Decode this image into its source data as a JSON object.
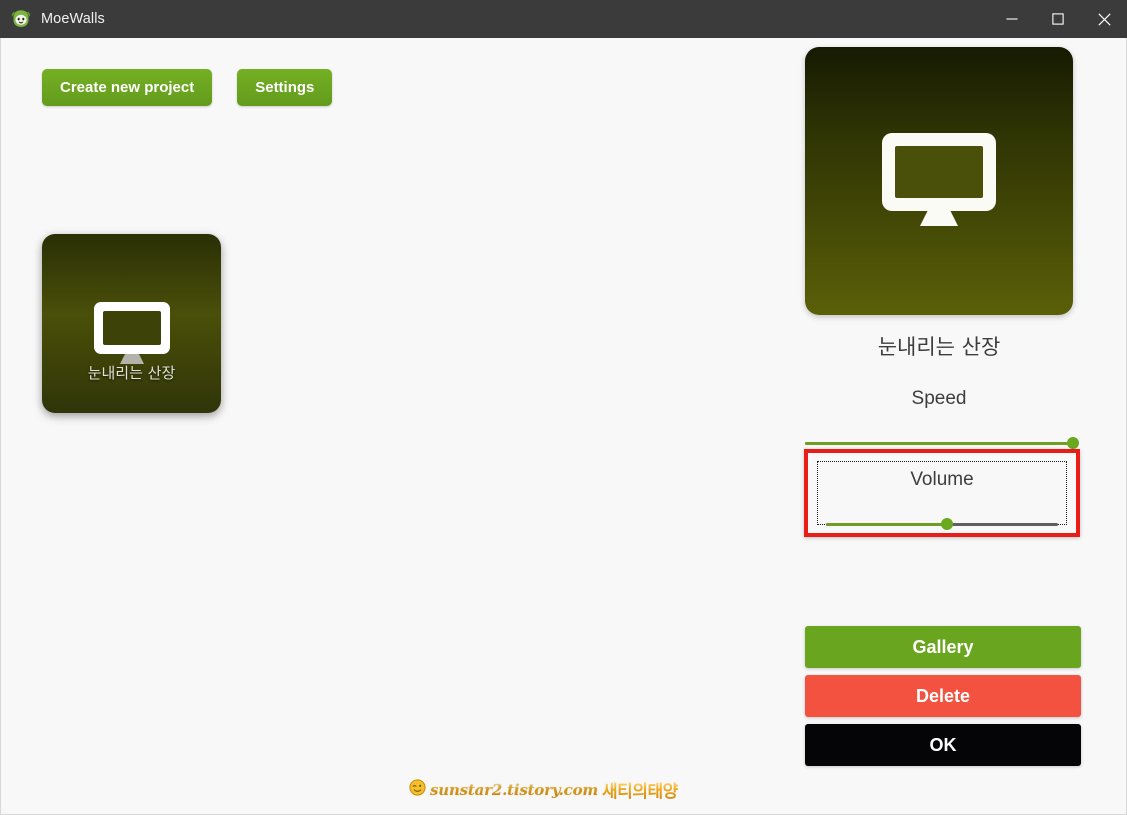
{
  "window": {
    "title": "MoeWalls",
    "icon": "moewalls-mascot-icon",
    "controls": {
      "minimize": "—",
      "maximize": "□",
      "close": "✕"
    }
  },
  "toolbar": {
    "create_label": "Create new project",
    "settings_label": "Settings"
  },
  "projects": [
    {
      "label": "눈내리는 산장",
      "icon": "monitor-icon"
    }
  ],
  "preview": {
    "icon": "monitor-icon",
    "title": "눈내리는 산장"
  },
  "sliders": {
    "speed": {
      "label": "Speed",
      "value": 100,
      "min": 0,
      "max": 100
    },
    "volume": {
      "label": "Volume",
      "value": 52,
      "min": 0,
      "max": 100,
      "highlighted": true,
      "highlight_color": "#e81d18"
    }
  },
  "actions": {
    "gallery_label": "Gallery",
    "delete_label": "Delete",
    "ok_label": "OK"
  },
  "watermark": {
    "url": "sunstar2.tistory.com",
    "brand": "새티의태양",
    "icon": "wink-face-icon"
  },
  "colors": {
    "accent_green": "#6aa520",
    "danger_red": "#f2523f",
    "annotation_red": "#e81d18",
    "titlebar": "#3b3b3b",
    "page_background": "#f8f8f8"
  }
}
